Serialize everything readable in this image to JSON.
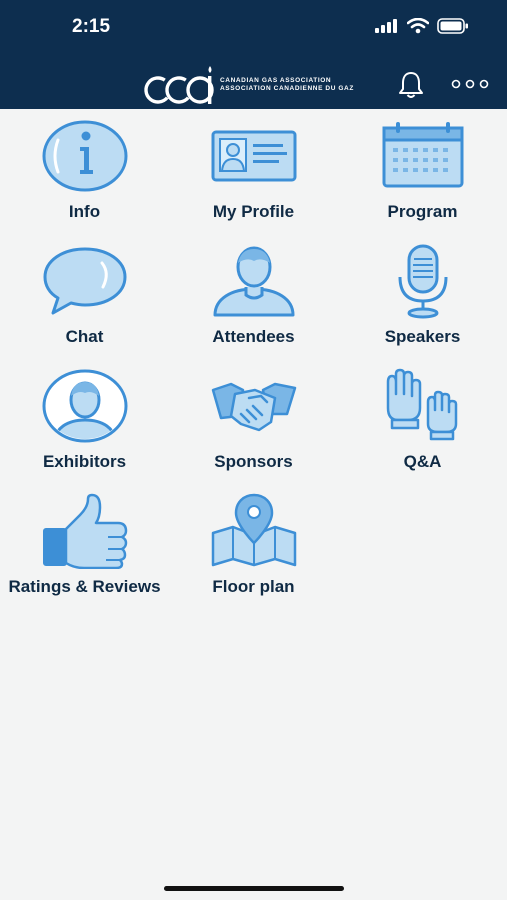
{
  "status_bar": {
    "time": "2:15"
  },
  "header": {
    "logo": {
      "mark": "CGA",
      "line1": "CANADIAN GAS ASSOCIATION",
      "line2": "ASSOCIATION CANADIENNE DU GAZ"
    },
    "icons": [
      "bell-icon",
      "more-icon"
    ]
  },
  "tiles": [
    {
      "label": "Info",
      "icon": "info-icon"
    },
    {
      "label": "My Profile",
      "icon": "id-card-icon"
    },
    {
      "label": "Program",
      "icon": "calendar-icon"
    },
    {
      "label": "Chat",
      "icon": "chat-bubble-icon"
    },
    {
      "label": "Attendees",
      "icon": "person-icon"
    },
    {
      "label": "Speakers",
      "icon": "microphone-icon"
    },
    {
      "label": "Exhibitors",
      "icon": "person-circle-icon"
    },
    {
      "label": "Sponsors",
      "icon": "handshake-icon"
    },
    {
      "label": "Q&A",
      "icon": "raised-hands-icon"
    },
    {
      "label": "Ratings & Reviews",
      "icon": "thumbs-up-icon"
    },
    {
      "label": "Floor plan",
      "icon": "map-pin-icon"
    }
  ],
  "colors": {
    "header": "#0d2e4f",
    "icon_fill": "#bcdcf3",
    "icon_stroke": "#3d8fd6",
    "label": "#0f2a44",
    "background": "#f3f4f4"
  }
}
